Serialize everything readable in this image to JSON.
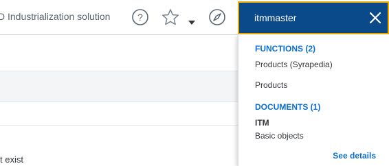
{
  "header": {
    "app_title": "D Industrialization solution",
    "icons": [
      "help-icon",
      "star-icon",
      "chevron-down-icon",
      "compass-icon"
    ]
  },
  "search": {
    "value": "itmmaster",
    "close_icon": "close-icon"
  },
  "results": {
    "functions_header": "FUNCTIONS (2)",
    "functions": [
      {
        "label": "Products (Syrapedia)"
      },
      {
        "label": "Products"
      }
    ],
    "documents_header": "DOCUMENTS (1)",
    "documents": [
      {
        "title": "ITM",
        "subtitle": "Basic objects"
      }
    ],
    "see_details": "See details"
  },
  "background": {
    "partial_text": "t exist"
  },
  "colors": {
    "search_bg": "#0a4a8b",
    "search_border": "#f0ab00",
    "link": "#0a6ed1",
    "text": "#32363a"
  }
}
